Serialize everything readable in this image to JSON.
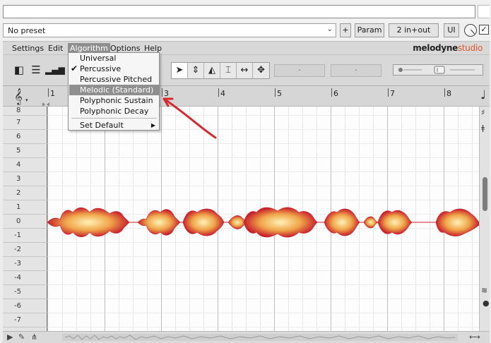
{
  "host": {
    "preset": "No preset",
    "plus_label": "+",
    "param_label": "Param",
    "io_label": "2 in+out",
    "ui_label": "UI",
    "bypass_checked": "✓"
  },
  "menubar": {
    "items": [
      "Settings",
      "Edit",
      "Algorithm",
      "Options",
      "Help"
    ],
    "logo_main": "melodyne",
    "logo_sub": "studio"
  },
  "algorithm_menu": {
    "items": [
      {
        "label": "Universal",
        "checked": false,
        "highlighted": false
      },
      {
        "label": "Percussive",
        "checked": true,
        "highlighted": false
      },
      {
        "label": "Percussive Pitched",
        "checked": false,
        "highlighted": false
      },
      {
        "label": "Melodic (Standard)",
        "checked": false,
        "highlighted": true
      },
      {
        "label": "Polyphonic Sustain",
        "checked": false,
        "highlighted": false
      },
      {
        "label": "Polyphonic Decay",
        "checked": false,
        "highlighted": false
      }
    ],
    "set_default": "Set Default"
  },
  "toolbar": {
    "field1": "-",
    "field2": "-"
  },
  "ruler": {
    "bars": [
      "1",
      "3",
      "4",
      "5",
      "6",
      "7",
      "8"
    ]
  },
  "pitch_ruler": {
    "labels": [
      "8",
      "7",
      "6",
      "5",
      "4",
      "3",
      "2",
      "1",
      "0",
      "-1",
      "-2",
      "-3",
      "-4",
      "-5",
      "-6",
      "-7"
    ]
  },
  "colors": {
    "blob_outer": "#c8202c",
    "blob_mid": "#f0a64a",
    "blob_center": "#fff2b8",
    "annotation_arrow": "#d42a30",
    "menu_highlight": "#8f8f8f"
  }
}
